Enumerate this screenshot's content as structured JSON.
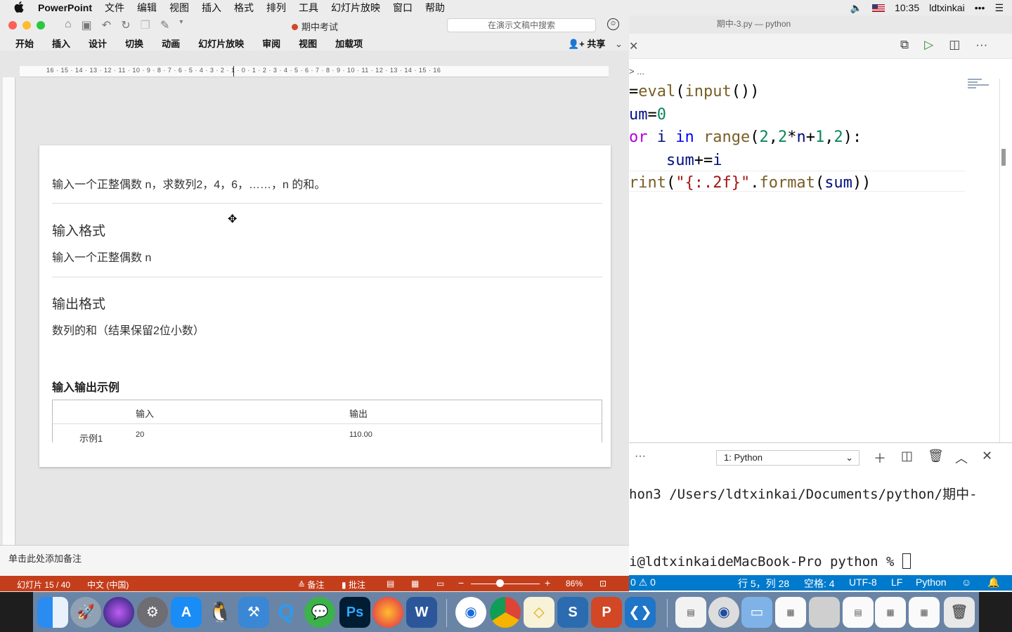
{
  "menubar": {
    "app": "PowerPoint",
    "items": [
      "文件",
      "编辑",
      "视图",
      "插入",
      "格式",
      "排列",
      "工具",
      "幻灯片放映",
      "窗口",
      "帮助"
    ],
    "time": "10:35",
    "user": "ldtxinkai"
  },
  "ppt": {
    "doc_title": "期中考试",
    "search_placeholder": "在演示文稿中搜索",
    "tabs": [
      "开始",
      "插入",
      "设计",
      "切换",
      "动画",
      "幻灯片放映",
      "审阅",
      "视图",
      "加载项"
    ],
    "share": "共享",
    "ruler_labels": "16 · 15 · 14 · 13 · 12 · 11 · 10 · 9 · 8 · 7 · 6 · 5 · 4 · 3 · 2 · 1 · 0 · 1 · 2 · 3 · 4 · 5 · 6 · 7 · 8 · 9 · 10 · 11 · 12 · 13 · 14 · 15 · 16",
    "slide": {
      "description": "输入一个正整偶数 n，求数列2，4，6，……，n 的和。",
      "input_format_title": "输入格式",
      "input_format_text": "输入一个正整偶数 n",
      "output_format_title": "输出格式",
      "output_format_text": "数列的和（结果保留2位小数）",
      "example_title": "输入输出示例",
      "table": {
        "headers": [
          "",
          "输入",
          "输出"
        ],
        "rows": [
          [
            "示例1",
            "20",
            "110.00"
          ]
        ]
      }
    },
    "notes_placeholder": "单击此处添加备注",
    "status": {
      "slide": "幻灯片 15 / 40",
      "language": "中文 (中国)",
      "notes": "备注",
      "comments": "批注",
      "zoom": "86%"
    }
  },
  "vscode": {
    "title": "期中-3.py — python",
    "breadcrumb": "> ...",
    "code_lines": [
      "=eval(input())",
      "um=0",
      "or i in range(2,2*n+1,2):",
      "    sum+=i",
      "rint(\"{:.2f}\".format(sum))"
    ],
    "terminal_select": "1: Python",
    "terminal_line1": "hon3 /Users/ldtxinkai/Documents/python/期中-",
    "terminal_prompt": "i@ldtxinkaideMacBook-Pro python % ",
    "status": {
      "problems": "0 ⚠ 0",
      "position": "行 5，列 28",
      "spaces": "空格: 4",
      "encoding": "UTF-8",
      "eol": "LF",
      "language": "Python"
    }
  },
  "dock": {
    "apps": [
      "finder",
      "launchpad",
      "siri",
      "system-preferences",
      "app-store",
      "qq",
      "xcode",
      "quicktime",
      "wechat",
      "photoshop",
      "firefox",
      "word",
      "wifi",
      "chrome",
      "sketch",
      "sublime",
      "powerpoint",
      "vscode",
      "preview-doc",
      "stack",
      "folder",
      "screenshot",
      "screenshot",
      "file",
      "screenshot",
      "screenshot",
      "trash"
    ],
    "ps_label": "Ps",
    "w_label": "W",
    "p_label": "P",
    "s_label": "S"
  },
  "colors": {
    "ppt_accent": "#c43e1c",
    "vscode_status": "#007acc",
    "slide_bg": "#ffffff"
  }
}
